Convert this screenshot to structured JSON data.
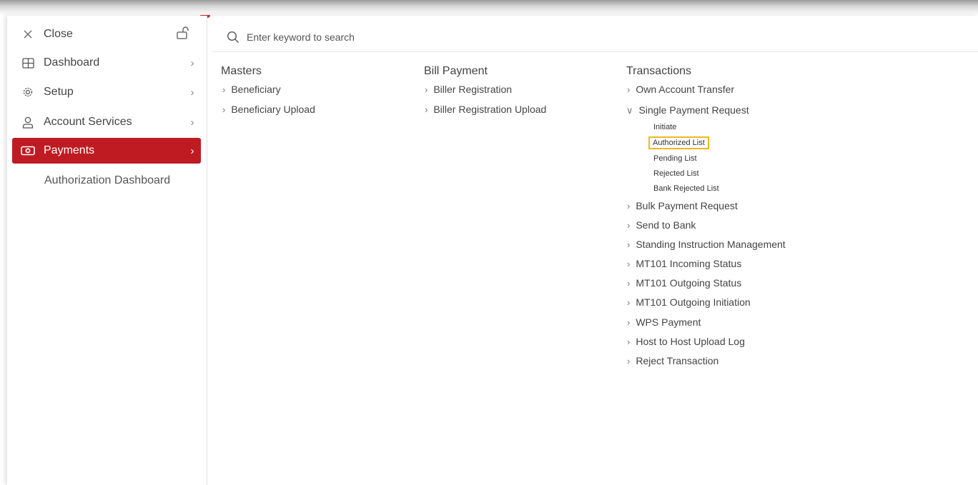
{
  "sidebar": {
    "close": {
      "label": "Close",
      "icon": "close-icon"
    },
    "items": [
      {
        "label": "Dashboard",
        "icon": "grid-icon"
      },
      {
        "label": "Setup",
        "icon": "gear-icon"
      },
      {
        "label": "Account Services",
        "icon": "user-icon"
      },
      {
        "label": "Payments",
        "icon": "money-icon",
        "active": true
      }
    ],
    "sub_item": "Authorization Dashboard",
    "active_color": "#bf1b22"
  },
  "search": {
    "placeholder": "Enter keyword to search"
  },
  "columns": {
    "masters": {
      "title": "Masters",
      "links": [
        "Beneficiary",
        "Beneficiary Upload"
      ]
    },
    "bill_payment": {
      "title": "Bill Payment",
      "links": [
        "Biller Registration",
        "Biller Registration Upload"
      ]
    },
    "transactions": {
      "title": "Transactions",
      "links_before": [
        "Own Account Transfer"
      ],
      "expanded": {
        "label": "Single Payment Request",
        "children": [
          "Initiate",
          "Authorized List",
          "Pending List",
          "Rejected List",
          "Bank Rejected List"
        ],
        "highlighted": "Authorized List"
      },
      "links_after": [
        "Bulk Payment Request",
        "Send to Bank",
        "Standing Instruction Management",
        "MT101 Incoming Status",
        "MT101 Outgoing Status",
        "MT101 Outgoing Initiation",
        "WPS Payment",
        "Host to Host Upload Log",
        "Reject Transaction"
      ]
    }
  },
  "highlight_color": "#f2b71f"
}
